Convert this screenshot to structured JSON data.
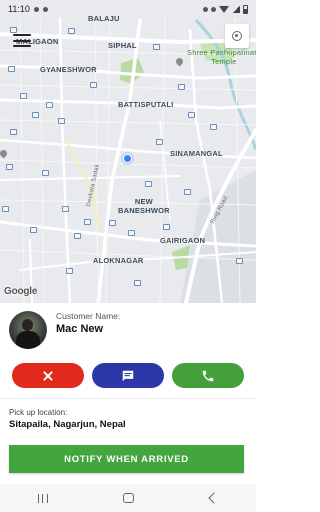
{
  "status_bar": {
    "time": "11:10"
  },
  "map": {
    "labels": {
      "balaju": "BALAJU",
      "malaigaon": "MALIGAON",
      "siphal": "SIPHAL",
      "pashupatinath": "Shree Pashupatinath\nTemple",
      "gyaneshwor": "GYANESHWOR",
      "battisputali": "BATTISPUTALI",
      "sinamangal": "SINAMANGAL",
      "devkota_sadak": "Devkota Sadak",
      "new_baneshwor": "NEW\nBANESHWOR",
      "ring_road": "Ring Road",
      "gairigaon": "GAIRIGAON",
      "aloknagar": "ALOKNAGAR"
    },
    "attribution": "Google",
    "colors": {
      "road": "#ffffff",
      "park": "#b9dba3",
      "water": "#aad3df",
      "user_dot": "#3c7ff2"
    }
  },
  "customer": {
    "label": "Customer Name:",
    "name": "Mac New"
  },
  "actions": {
    "cancel": {
      "icon": "close-icon",
      "color": "#e02a1e"
    },
    "message": {
      "icon": "message-icon",
      "color": "#2e37a8"
    },
    "call": {
      "icon": "phone-icon",
      "color": "#45a03c"
    }
  },
  "pickup": {
    "label": "Pick up location:",
    "value": "Sitapaila, Nagarjun, Nepal"
  },
  "notify_button": {
    "label": "NOTIFY WHEN ARRIVED",
    "color": "#42a53e"
  },
  "nav_bar": {
    "recent": "recent-apps-icon",
    "home": "home-icon",
    "back": "back-icon"
  }
}
